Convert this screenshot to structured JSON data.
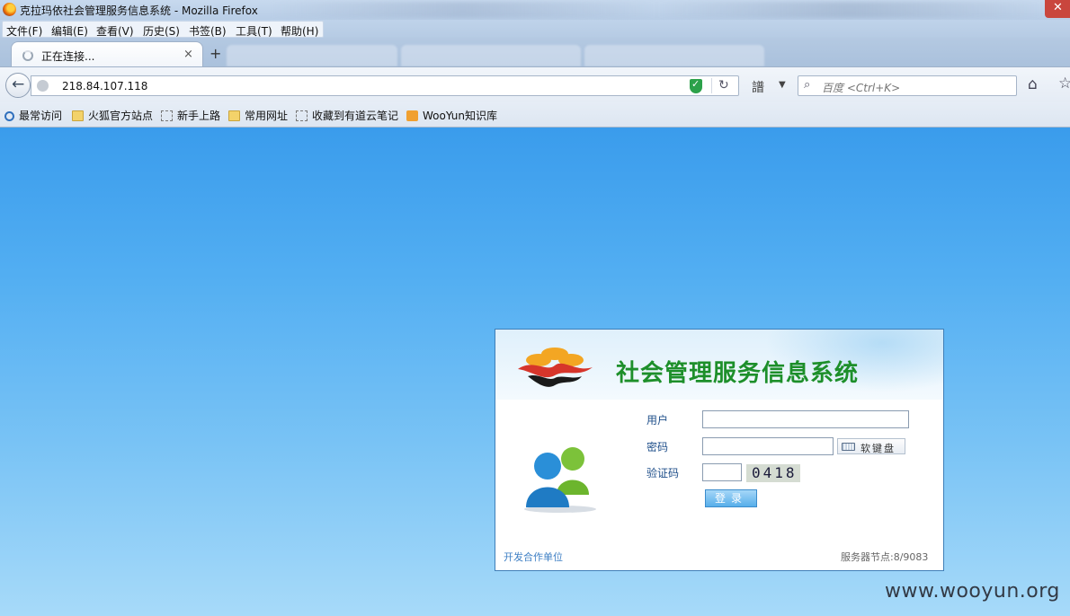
{
  "window": {
    "title": "克拉玛依社会管理服务信息系统 - Mozilla Firefox"
  },
  "menubar": {
    "items": [
      "文件(F)",
      "编辑(E)",
      "查看(V)",
      "历史(S)",
      "书签(B)",
      "工具(T)",
      "帮助(H)"
    ]
  },
  "tabs": {
    "active_title": "正在连接...",
    "close_glyph": "×",
    "new_tab_glyph": "+"
  },
  "navbar": {
    "url": "218.84.107.118",
    "search_placeholder": "百度 <Ctrl+K>"
  },
  "bookmarks": {
    "items": [
      {
        "label": "最常访问",
        "icon": "search-icon"
      },
      {
        "label": "火狐官方站点",
        "icon": "folder-icon"
      },
      {
        "label": "新手上路",
        "icon": "page-icon"
      },
      {
        "label": "常用网址",
        "icon": "folder-icon"
      },
      {
        "label": "收藏到有道云笔记",
        "icon": "page-icon"
      },
      {
        "label": "WooYun知识库",
        "icon": "rss-icon"
      }
    ]
  },
  "login": {
    "system_title": "社会管理服务信息系统",
    "user_label": "用户",
    "password_label": "密码",
    "captcha_label": "验证码",
    "user_value": "",
    "password_value": "",
    "captcha_value": "",
    "keyboard_label": "软键盘",
    "captcha_code": "0418",
    "submit_label": "登录",
    "dev_link": "开发合作单位",
    "server_node": "服务器节点:8/9083"
  },
  "watermark": "www.wooyun.org",
  "colors": {
    "title_green": "#1d8f2a",
    "page_blue": "#52aef2",
    "label_blue": "#1f4f8a"
  }
}
